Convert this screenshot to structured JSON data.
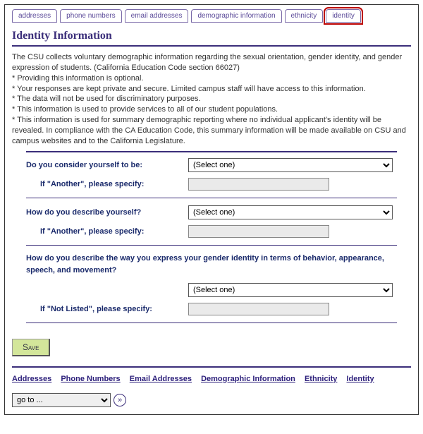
{
  "tabs": {
    "addresses": "addresses",
    "phone_numbers": "phone numbers",
    "email_addresses": "email addresses",
    "demographic": "demographic information",
    "ethnicity": "ethnicity",
    "identity": "identity"
  },
  "title": "Identity Information",
  "intro": {
    "p1": "The CSU collects voluntary demographic information regarding the sexual orientation, gender identity, and gender expression of students. (California Education Code section 66027)",
    "b1": "* Providing this information is optional.",
    "b2": "* Your responses are kept private and secure. Limited campus staff will have access to this information.",
    "b3": "* The data will not be used for discriminatory purposes.",
    "b4": "* This information is used to provide services to all of our student populations.",
    "b5": "* This information is used for summary demographic reporting where no individual applicant's identity will be revealed. In compliance with the CA Education Code, this summary information will be made available on CSU and campus websites and to the California Legislature."
  },
  "q1": {
    "label": "Do you consider yourself to be:",
    "select": "(Select one)",
    "specify_label": "If \"Another\", please specify:",
    "specify_value": ""
  },
  "q2": {
    "label": "How do you describe yourself?",
    "select": "(Select one)",
    "specify_label": "If \"Another\", please specify:",
    "specify_value": ""
  },
  "q3": {
    "label": "How do you describe the way you express your gender identity in terms of behavior, appearance, speech, and movement?",
    "select": "(Select one)",
    "specify_label": "If \"Not Listed\", please specify:",
    "specify_value": ""
  },
  "save_label": "Save",
  "bottom_links": {
    "addresses": "Addresses",
    "phone_numbers": "Phone Numbers",
    "email_addresses": "Email Addresses",
    "demographic": "Demographic Information",
    "ethnicity": "Ethnicity",
    "identity": "Identity"
  },
  "goto": {
    "selected": "go to ...",
    "go_glyph": "»"
  }
}
